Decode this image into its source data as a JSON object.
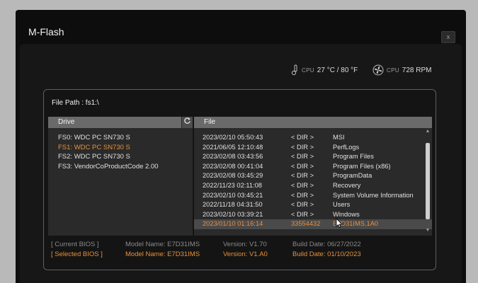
{
  "window": {
    "title": "M-Flash",
    "close_label": "x"
  },
  "sensors": {
    "cpu_temp": {
      "icon": "thermometer-icon",
      "label": "CPU",
      "value": "27 °C / 80 °F"
    },
    "cpu_fan": {
      "icon": "fan-icon",
      "label": "CPU",
      "value": "728 RPM"
    }
  },
  "file_path": "File Path :  fs1:\\",
  "drive_pane": {
    "header": "Drive",
    "refresh_icon": "refresh-icon",
    "items": [
      {
        "label": "FS0: WDC PC SN730 S"
      },
      {
        "label": "FS1: WDC PC SN730 S",
        "selected": true
      },
      {
        "label": "FS2: WDC PC SN730 S"
      },
      {
        "label": "FS3: VendorCoProductCode 2.00"
      }
    ]
  },
  "file_pane": {
    "header": "File",
    "rows": [
      {
        "date": "2023/02/10 05:50:43",
        "size": "< DIR >",
        "name": "MSI"
      },
      {
        "date": "2021/06/05 12:10:48",
        "size": "< DIR >",
        "name": "PerfLogs"
      },
      {
        "date": "2023/02/08 03:43:56",
        "size": "< DIR >",
        "name": "Program Files"
      },
      {
        "date": "2023/02/08 00:41:04",
        "size": "< DIR >",
        "name": "Program Files (x86)"
      },
      {
        "date": "2023/02/08 03:45:29",
        "size": "< DIR >",
        "name": "ProgramData"
      },
      {
        "date": "2022/11/23 02:11:08",
        "size": "< DIR >",
        "name": "Recovery"
      },
      {
        "date": "2023/02/10 03:45:21",
        "size": "< DIR >",
        "name": "System Volume Information"
      },
      {
        "date": "2022/11/18 04:31:50",
        "size": "< DIR >",
        "name": "Users"
      },
      {
        "date": "2023/02/10 03:39:21",
        "size": "< DIR >",
        "name": "Windows"
      },
      {
        "date": "2023/01/10 01:16:14",
        "size": "33554432",
        "name": "E7D31IMS.1A0",
        "selected": true
      }
    ]
  },
  "bios": {
    "current": {
      "tag": "[ Current BIOS ]",
      "model": "Model Name: E7D31IMS",
      "version": "Version: V1.70",
      "build": "Build Date: 06/27/2022"
    },
    "selected": {
      "tag": "[ Selected BIOS ]",
      "model": "Model Name: E7D31IMS",
      "version": "Version: V1.A0",
      "build": "Build Date: 01/10/2023"
    }
  },
  "colors": {
    "accent": "#e8913a",
    "background": "#171717",
    "header": "#6a6a6a"
  }
}
